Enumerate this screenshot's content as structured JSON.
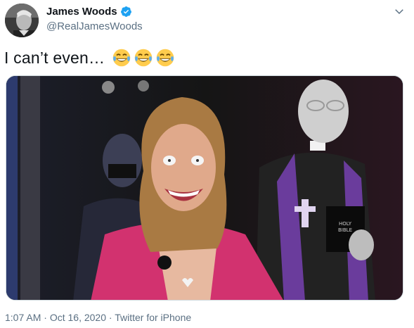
{
  "author": {
    "name": "James Woods",
    "handle": "@RealJamesWoods",
    "verified": true,
    "avatar": "profile-photo"
  },
  "tweet": {
    "text": "I can’t even…",
    "emojis": [
      "face-with-tears-of-joy",
      "face-with-tears-of-joy",
      "face-with-tears-of-joy"
    ]
  },
  "media": {
    "type": "photo",
    "alt": "image"
  },
  "meta": {
    "time": "1:07 AM",
    "separator": " · ",
    "date": "Oct 16, 2020",
    "source": "Twitter for iPhone"
  },
  "colors": {
    "verified_badge": "#1da1f2",
    "secondary_text": "#5b7083",
    "purple_stole": "#6a3c9c",
    "pink_blazer": "#d2326f"
  }
}
